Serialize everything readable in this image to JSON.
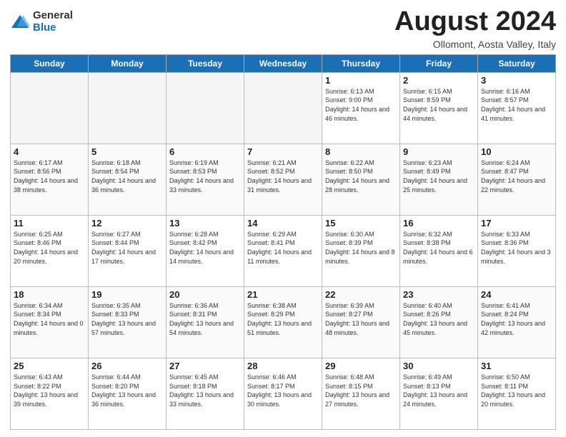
{
  "header": {
    "logo_general": "General",
    "logo_blue": "Blue",
    "title": "August 2024",
    "location": "Ollomont, Aosta Valley, Italy"
  },
  "days_of_week": [
    "Sunday",
    "Monday",
    "Tuesday",
    "Wednesday",
    "Thursday",
    "Friday",
    "Saturday"
  ],
  "weeks": [
    [
      {
        "num": "",
        "info": ""
      },
      {
        "num": "",
        "info": ""
      },
      {
        "num": "",
        "info": ""
      },
      {
        "num": "",
        "info": ""
      },
      {
        "num": "1",
        "info": "Sunrise: 6:13 AM\nSunset: 9:00 PM\nDaylight: 14 hours and 46 minutes."
      },
      {
        "num": "2",
        "info": "Sunrise: 6:15 AM\nSunset: 8:59 PM\nDaylight: 14 hours and 44 minutes."
      },
      {
        "num": "3",
        "info": "Sunrise: 6:16 AM\nSunset: 8:57 PM\nDaylight: 14 hours and 41 minutes."
      }
    ],
    [
      {
        "num": "4",
        "info": "Sunrise: 6:17 AM\nSunset: 8:56 PM\nDaylight: 14 hours and 38 minutes."
      },
      {
        "num": "5",
        "info": "Sunrise: 6:18 AM\nSunset: 8:54 PM\nDaylight: 14 hours and 36 minutes."
      },
      {
        "num": "6",
        "info": "Sunrise: 6:19 AM\nSunset: 8:53 PM\nDaylight: 14 hours and 33 minutes."
      },
      {
        "num": "7",
        "info": "Sunrise: 6:21 AM\nSunset: 8:52 PM\nDaylight: 14 hours and 31 minutes."
      },
      {
        "num": "8",
        "info": "Sunrise: 6:22 AM\nSunset: 8:50 PM\nDaylight: 14 hours and 28 minutes."
      },
      {
        "num": "9",
        "info": "Sunrise: 6:23 AM\nSunset: 8:49 PM\nDaylight: 14 hours and 25 minutes."
      },
      {
        "num": "10",
        "info": "Sunrise: 6:24 AM\nSunset: 8:47 PM\nDaylight: 14 hours and 22 minutes."
      }
    ],
    [
      {
        "num": "11",
        "info": "Sunrise: 6:25 AM\nSunset: 8:46 PM\nDaylight: 14 hours and 20 minutes."
      },
      {
        "num": "12",
        "info": "Sunrise: 6:27 AM\nSunset: 8:44 PM\nDaylight: 14 hours and 17 minutes."
      },
      {
        "num": "13",
        "info": "Sunrise: 6:28 AM\nSunset: 8:42 PM\nDaylight: 14 hours and 14 minutes."
      },
      {
        "num": "14",
        "info": "Sunrise: 6:29 AM\nSunset: 8:41 PM\nDaylight: 14 hours and 11 minutes."
      },
      {
        "num": "15",
        "info": "Sunrise: 6:30 AM\nSunset: 8:39 PM\nDaylight: 14 hours and 8 minutes."
      },
      {
        "num": "16",
        "info": "Sunrise: 6:32 AM\nSunset: 8:38 PM\nDaylight: 14 hours and 6 minutes."
      },
      {
        "num": "17",
        "info": "Sunrise: 6:33 AM\nSunset: 8:36 PM\nDaylight: 14 hours and 3 minutes."
      }
    ],
    [
      {
        "num": "18",
        "info": "Sunrise: 6:34 AM\nSunset: 8:34 PM\nDaylight: 14 hours and 0 minutes."
      },
      {
        "num": "19",
        "info": "Sunrise: 6:35 AM\nSunset: 8:33 PM\nDaylight: 13 hours and 57 minutes."
      },
      {
        "num": "20",
        "info": "Sunrise: 6:36 AM\nSunset: 8:31 PM\nDaylight: 13 hours and 54 minutes."
      },
      {
        "num": "21",
        "info": "Sunrise: 6:38 AM\nSunset: 8:29 PM\nDaylight: 13 hours and 51 minutes."
      },
      {
        "num": "22",
        "info": "Sunrise: 6:39 AM\nSunset: 8:27 PM\nDaylight: 13 hours and 48 minutes."
      },
      {
        "num": "23",
        "info": "Sunrise: 6:40 AM\nSunset: 8:26 PM\nDaylight: 13 hours and 45 minutes."
      },
      {
        "num": "24",
        "info": "Sunrise: 6:41 AM\nSunset: 8:24 PM\nDaylight: 13 hours and 42 minutes."
      }
    ],
    [
      {
        "num": "25",
        "info": "Sunrise: 6:43 AM\nSunset: 8:22 PM\nDaylight: 13 hours and 39 minutes."
      },
      {
        "num": "26",
        "info": "Sunrise: 6:44 AM\nSunset: 8:20 PM\nDaylight: 13 hours and 36 minutes."
      },
      {
        "num": "27",
        "info": "Sunrise: 6:45 AM\nSunset: 8:18 PM\nDaylight: 13 hours and 33 minutes."
      },
      {
        "num": "28",
        "info": "Sunrise: 6:46 AM\nSunset: 8:17 PM\nDaylight: 13 hours and 30 minutes."
      },
      {
        "num": "29",
        "info": "Sunrise: 6:48 AM\nSunset: 8:15 PM\nDaylight: 13 hours and 27 minutes."
      },
      {
        "num": "30",
        "info": "Sunrise: 6:49 AM\nSunset: 8:13 PM\nDaylight: 13 hours and 24 minutes."
      },
      {
        "num": "31",
        "info": "Sunrise: 6:50 AM\nSunset: 8:11 PM\nDaylight: 13 hours and 20 minutes."
      }
    ]
  ]
}
